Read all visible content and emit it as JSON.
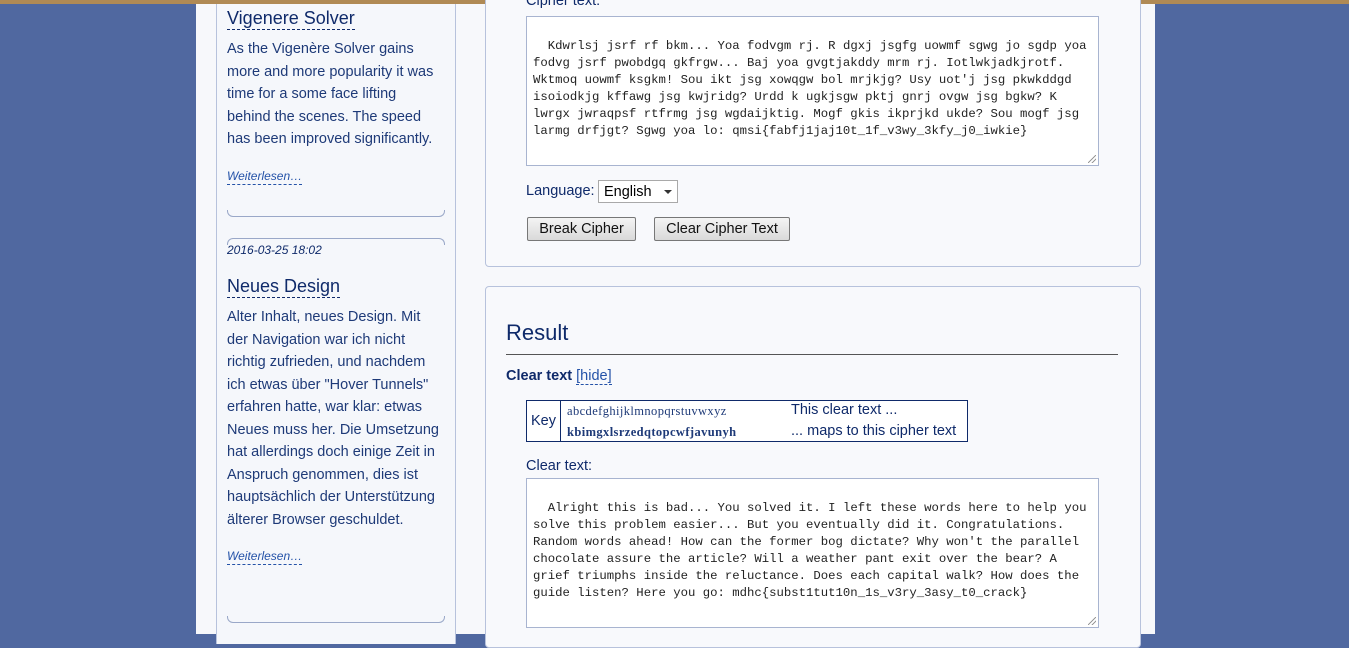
{
  "sidebar": {
    "posts": [
      {
        "title": "Vigenere Solver",
        "body": "As the Vigenère Solver gains more and more popularity it was time for a some face lifting behind the scenes. The speed has been improved significantly.",
        "read_more": "Weiterlesen…"
      },
      {
        "date": "2016-03-25 18:02",
        "title": "Neues Design",
        "body": "Alter Inhalt, neues Design. Mit der Navigation war ich nicht richtig zufrieden, und nachdem ich etwas über \"Hover Tunnels\" erfahren hatte, war klar: etwas Neues muss her. Die Umsetzung hat allerdings doch einige Zeit in Anspruch genommen, dies ist hauptsächlich der Unterstützung älterer Browser geschuldet.",
        "read_more": "Weiterlesen…"
      }
    ]
  },
  "input_panel": {
    "cipher_label": "Cipher text:",
    "cipher_text": "Kdwrlsj jsrf rf bkm... Yoa fodvgm rj. R dgxj jsgfg uowmf sgwg jo sgdp yoa fodvg jsrf pwobdgq gkfrgw... Baj yoa gvgtjakddy mrm rj. Iotlwkjadkjrotf. Wktmoq uowmf ksgkm! Sou ikt jsg xowqgw bol mrjkjg? Usy uot'j jsg pkwkddgd isoiodkjg kffawg jsg kwjridg? Urdd k ugkjsgw pktj gnrj ovgw jsg bgkw? K lwrgx jwraqpsf rtfrmg jsg wgdaijktig. Mogf gkis ikprjkd ukde? Sou mogf jsg larmg drfjgt? Sgwg yoa lo: qmsi{fabfj1jaj10t_1f_v3wy_3kfy_j0_iwkie}",
    "language_label": "Language:",
    "language_value": "English",
    "break_button": "Break Cipher",
    "clear_button": "Clear Cipher Text"
  },
  "result_panel": {
    "title": "Result",
    "clear_text_heading": "Clear text",
    "hide_link": "[hide]",
    "key": {
      "label": "Key",
      "plain_alphabet": "abcdefghijklmnopqrstuvwxyz",
      "cipher_alphabet": "kbimgxlsrzedqtopcwfjavunyh",
      "plain_desc": "This clear text ...",
      "cipher_desc": "... maps to this cipher text"
    },
    "clear_label": "Clear text:",
    "clear_text": "Alright this is bad... You solved it. I left these words here to help you solve this problem easier... But you eventually did it. Congratulations. Random words ahead! How can the former bog dictate? Why won't the parallel chocolate assure the article? Will a weather pant exit over the bear? A grief triumphs inside the reluctance. Does each capital walk? How does the guide listen? Here you go: mdhc{subst1tut10n_1s_v3ry_3asy_t0_crack}"
  }
}
